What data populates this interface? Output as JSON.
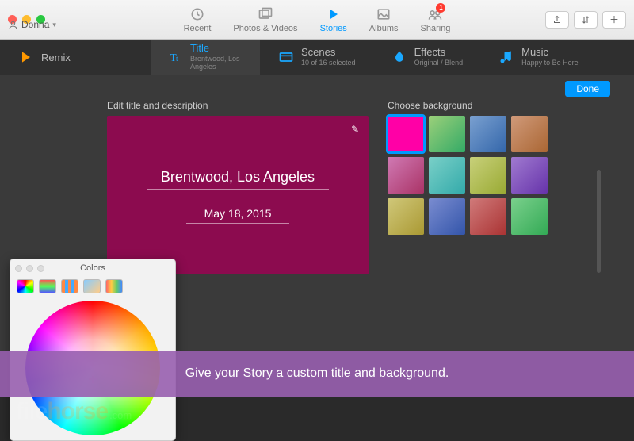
{
  "window": {
    "user": "Donna"
  },
  "topnav": {
    "items": [
      {
        "label": "Recent"
      },
      {
        "label": "Photos & Videos"
      },
      {
        "label": "Stories",
        "active": true
      },
      {
        "label": "Albums"
      },
      {
        "label": "Sharing",
        "badge": "1"
      }
    ]
  },
  "tabs": {
    "remix": {
      "label": "Remix"
    },
    "title": {
      "label": "Title",
      "sub": "Brentwood, Los Angeles"
    },
    "scenes": {
      "label": "Scenes",
      "sub": "10 of 16 selected"
    },
    "effects": {
      "label": "Effects",
      "sub": "Original / Blend"
    },
    "music": {
      "label": "Music",
      "sub": "Happy to Be Here"
    }
  },
  "done_label": "Done",
  "editor": {
    "edit_label": "Edit title and description",
    "title_value": "Brentwood, Los Angeles",
    "date_value": "May 18, 2015",
    "background_label": "Choose background",
    "selected_color": "#ff00a6"
  },
  "color_picker": {
    "title": "Colors"
  },
  "watermark": {
    "brand1": "file",
    "brand2": "horse",
    "domain": ".com"
  },
  "footer_caption": "Give your Story a custom title and background."
}
